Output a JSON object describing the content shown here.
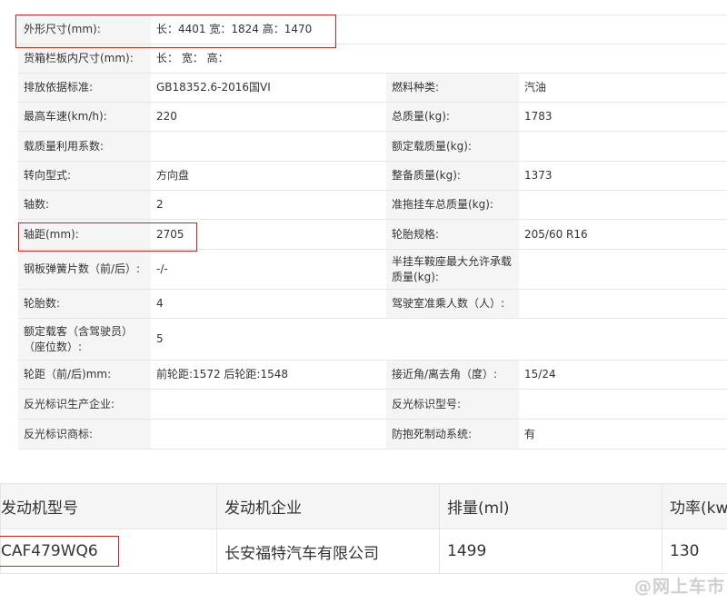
{
  "spec_rows": [
    [
      {
        "k": "外形尺寸(mm):",
        "v": "长：4401 宽：1824 高：1470",
        "span": true
      }
    ],
    [
      {
        "k": "货箱栏板内尺寸(mm):",
        "v": "长：  宽：  高：",
        "span": true
      }
    ],
    [
      {
        "k": "排放依据标准:",
        "v": "GB18352.6-2016国VI"
      },
      {
        "k": "燃料种类:",
        "v": "汽油"
      }
    ],
    [
      {
        "k": "最高车速(km/h):",
        "v": "220"
      },
      {
        "k": "总质量(kg):",
        "v": "1783"
      }
    ],
    [
      {
        "k": "载质量利用系数:",
        "v": ""
      },
      {
        "k": "额定载质量(kg):",
        "v": ""
      }
    ],
    [
      {
        "k": "转向型式:",
        "v": "方向盘"
      },
      {
        "k": "整备质量(kg):",
        "v": "1373"
      }
    ],
    [
      {
        "k": "轴数:",
        "v": "2"
      },
      {
        "k": "准拖挂车总质量(kg):",
        "v": ""
      }
    ],
    [
      {
        "k": "轴距(mm):",
        "v": "2705"
      },
      {
        "k": "轮胎规格:",
        "v": "205/60 R16"
      }
    ],
    [
      {
        "k": "钢板弹簧片数（前/后）:",
        "v": "-/-"
      },
      {
        "k": "半挂车鞍座最大允许承载质量(kg):",
        "v": ""
      }
    ],
    [
      {
        "k": "轮胎数:",
        "v": "4"
      },
      {
        "k": "驾驶室准乘人数（人）:",
        "v": ""
      }
    ],
    [
      {
        "k": "额定载客（含驾驶员）（座位数）:",
        "v": "5",
        "span": true
      }
    ],
    [
      {
        "k": "轮距（前/后)mm:",
        "v": "前轮距:1572 后轮距:1548"
      },
      {
        "k": "接近角/离去角（度）:",
        "v": "15/24"
      }
    ],
    [
      {
        "k": "反光标识生产企业:",
        "v": ""
      },
      {
        "k": "反光标识型号:",
        "v": ""
      }
    ],
    [
      {
        "k": "反光标识商标:",
        "v": ""
      },
      {
        "k": "防抱死制动系统:",
        "v": "有"
      }
    ]
  ],
  "engine": {
    "headers": [
      "发动机型号",
      "发动机企业",
      "排量(ml)",
      "功率(kw)"
    ],
    "row": [
      "CAF479WQ6",
      "长安福特汽车有限公司",
      "1499",
      "130"
    ]
  },
  "watermark": "@网上车市",
  "colors": {
    "highlight": "#cc2222",
    "key_bg": "#f5f5f5",
    "border": "#e6e6e6"
  }
}
